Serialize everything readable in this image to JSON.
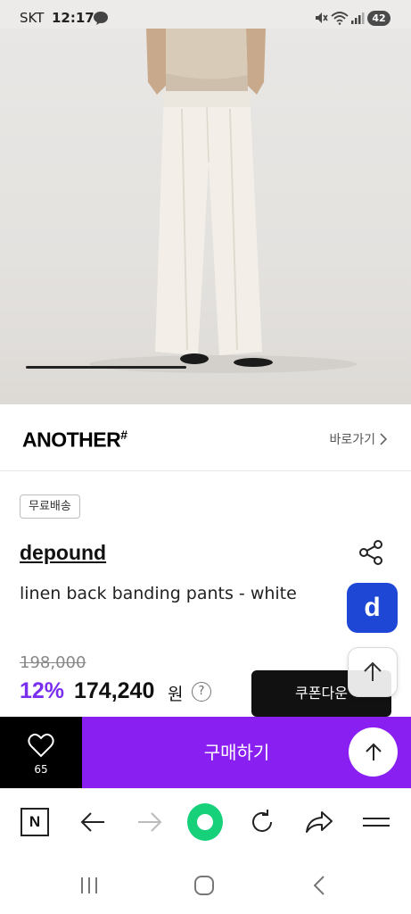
{
  "status_bar": {
    "carrier": "SKT",
    "time": "12:17",
    "battery": "42",
    "icons": [
      "chat-bubble-icon",
      "mute-icon",
      "wifi-icon",
      "signal-icon",
      "battery-icon"
    ]
  },
  "photo": {
    "description_icon": "product-photo",
    "carousel_progress": 0.42
  },
  "brand": {
    "logo": "ANOTHER",
    "logo_mark": "#",
    "shortcut_label": "바로가기"
  },
  "product": {
    "badge": "무료배송",
    "seller": "depound",
    "name": "linen back banding pants - white",
    "original_price": "198,000",
    "discount": "12%",
    "price": "174,240",
    "currency": "원",
    "help": "?",
    "coupon_label": "쿠폰다운",
    "app_badge_letter": "d"
  },
  "purchase_bar": {
    "like_count": "65",
    "buy_label": "구매하기"
  },
  "browser_bar": {
    "home_letter": "N",
    "icons": [
      "naver-home-icon",
      "back-arrow-icon",
      "forward-arrow-icon",
      "green-dot-icon",
      "refresh-icon",
      "share-arrow-icon",
      "menu-icon"
    ]
  },
  "system_nav": {
    "icons": [
      "recent-apps-icon",
      "home-icon",
      "back-icon"
    ]
  },
  "colors": {
    "accent_purple": "#8a1ff2",
    "discount_purple": "#7a2ff0",
    "app_blue": "#1f47d6",
    "green": "#1ec800"
  }
}
